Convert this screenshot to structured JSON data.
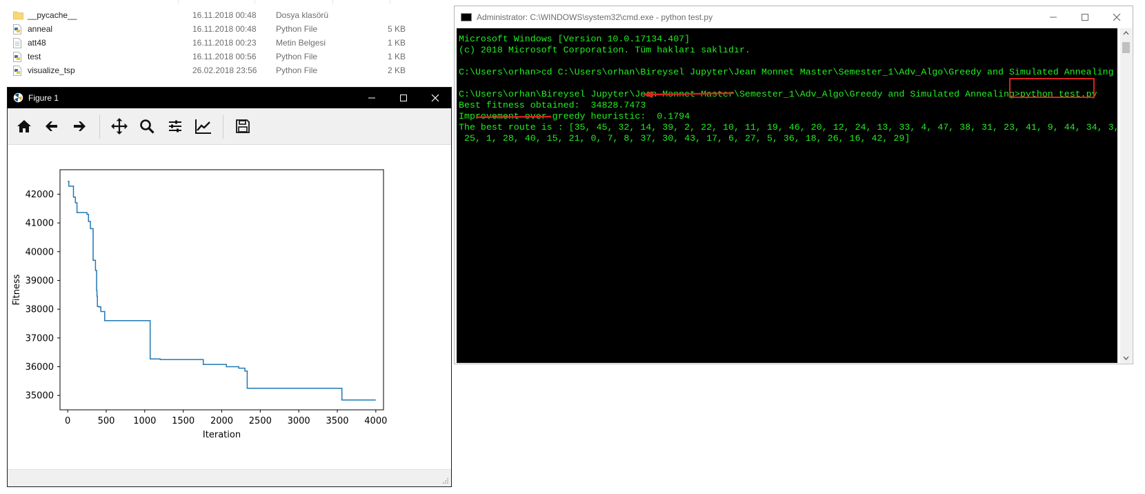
{
  "explorer": {
    "files": [
      {
        "name": "__pycache__",
        "date": "16.11.2018 00:48",
        "type": "Dosya klasörü",
        "size": "",
        "icon": "folder-icon"
      },
      {
        "name": "anneal",
        "date": "16.11.2018 00:48",
        "type": "Python File",
        "size": "5 KB",
        "icon": "python-file-icon"
      },
      {
        "name": "att48",
        "date": "16.11.2018 00:23",
        "type": "Metin Belgesi",
        "size": "1 KB",
        "icon": "text-file-icon"
      },
      {
        "name": "test",
        "date": "16.11.2018 00:56",
        "type": "Python File",
        "size": "1 KB",
        "icon": "python-file-icon"
      },
      {
        "name": "visualize_tsp",
        "date": "26.02.2018 23:56",
        "type": "Python File",
        "size": "2 KB",
        "icon": "python-file-icon"
      }
    ]
  },
  "figure": {
    "title": "Figure 1",
    "toolbar": [
      "home-icon",
      "back-arrow-icon",
      "forward-arrow-icon",
      "pan-icon",
      "zoom-icon",
      "configure-subplots-icon",
      "edit-axis-icon",
      "save-icon"
    ]
  },
  "chart_data": {
    "type": "line",
    "xlabel": "Iteration",
    "ylabel": "Fitness",
    "xlim": [
      -100,
      4100
    ],
    "ylim": [
      34500,
      42850
    ],
    "xticks": [
      0,
      500,
      1000,
      1500,
      2000,
      2500,
      3000,
      3500,
      4000
    ],
    "yticks": [
      35000,
      36000,
      37000,
      38000,
      39000,
      40000,
      41000,
      42000
    ],
    "grid": false,
    "color": "#1f77b4",
    "series": [
      {
        "x": [
          0,
          15,
          15,
          75,
          75,
          100,
          100,
          120,
          120,
          250,
          250,
          270,
          270,
          295,
          295,
          330,
          330,
          360,
          360,
          375,
          375,
          380,
          380,
          385,
          385,
          400,
          400,
          430,
          430,
          480,
          480,
          545,
          545,
          1070,
          1070,
          1200,
          1200,
          1760,
          1760,
          2060,
          2060,
          2220,
          2220,
          2300,
          2300,
          2330,
          2330,
          3560,
          3560,
          4000
        ],
        "y": [
          42450,
          42450,
          42280,
          42280,
          41900,
          41900,
          41700,
          41700,
          41360,
          41360,
          41300,
          41300,
          41050,
          41050,
          40800,
          40800,
          39700,
          39700,
          39350,
          39350,
          38650,
          38650,
          38450,
          38450,
          38100,
          38100,
          38080,
          38080,
          37920,
          37920,
          37600,
          37600,
          37600,
          37600,
          36270,
          36270,
          36250,
          36250,
          36080,
          36080,
          36000,
          36000,
          35950,
          35950,
          35850,
          35850,
          35250,
          35250,
          34840,
          34840
        ]
      }
    ]
  },
  "cmd": {
    "title": "Administrator: C:\\WINDOWS\\system32\\cmd.exe - python  test.py",
    "lines": [
      "Microsoft Windows [Version 10.0.17134.407]",
      "(c) 2018 Microsoft Corporation. Tüm hakları saklıdır.",
      "",
      "C:\\Users\\orhan>cd C:\\Users\\orhan\\Bireysel Jupyter\\Jean Monnet Master\\Semester_1\\Adv_Algo\\Greedy and Simulated Annealing",
      "",
      "C:\\Users\\orhan\\Bireysel Jupyter\\Jean Monnet Master\\Semester_1\\Adv_Algo\\Greedy and Simulated Annealing>python test.py",
      "Best fitness obtained:  34828.7473",
      "Improvement over greedy heuristic:  0.1794",
      "The best route is : [35, 45, 32, 14, 39, 2, 22, 10, 11, 19, 46, 20, 12, 24, 13, 33, 4, 47, 38, 31, 23, 41, 9, 44, 34, 3,",
      " 25, 1, 28, 40, 15, 21, 0, 7, 8, 37, 30, 43, 17, 6, 27, 5, 36, 18, 26, 16, 42, 29]"
    ]
  },
  "colors": {
    "console_text": "#22ee22",
    "annotation": "#e02020",
    "line": "#1f77b4"
  }
}
